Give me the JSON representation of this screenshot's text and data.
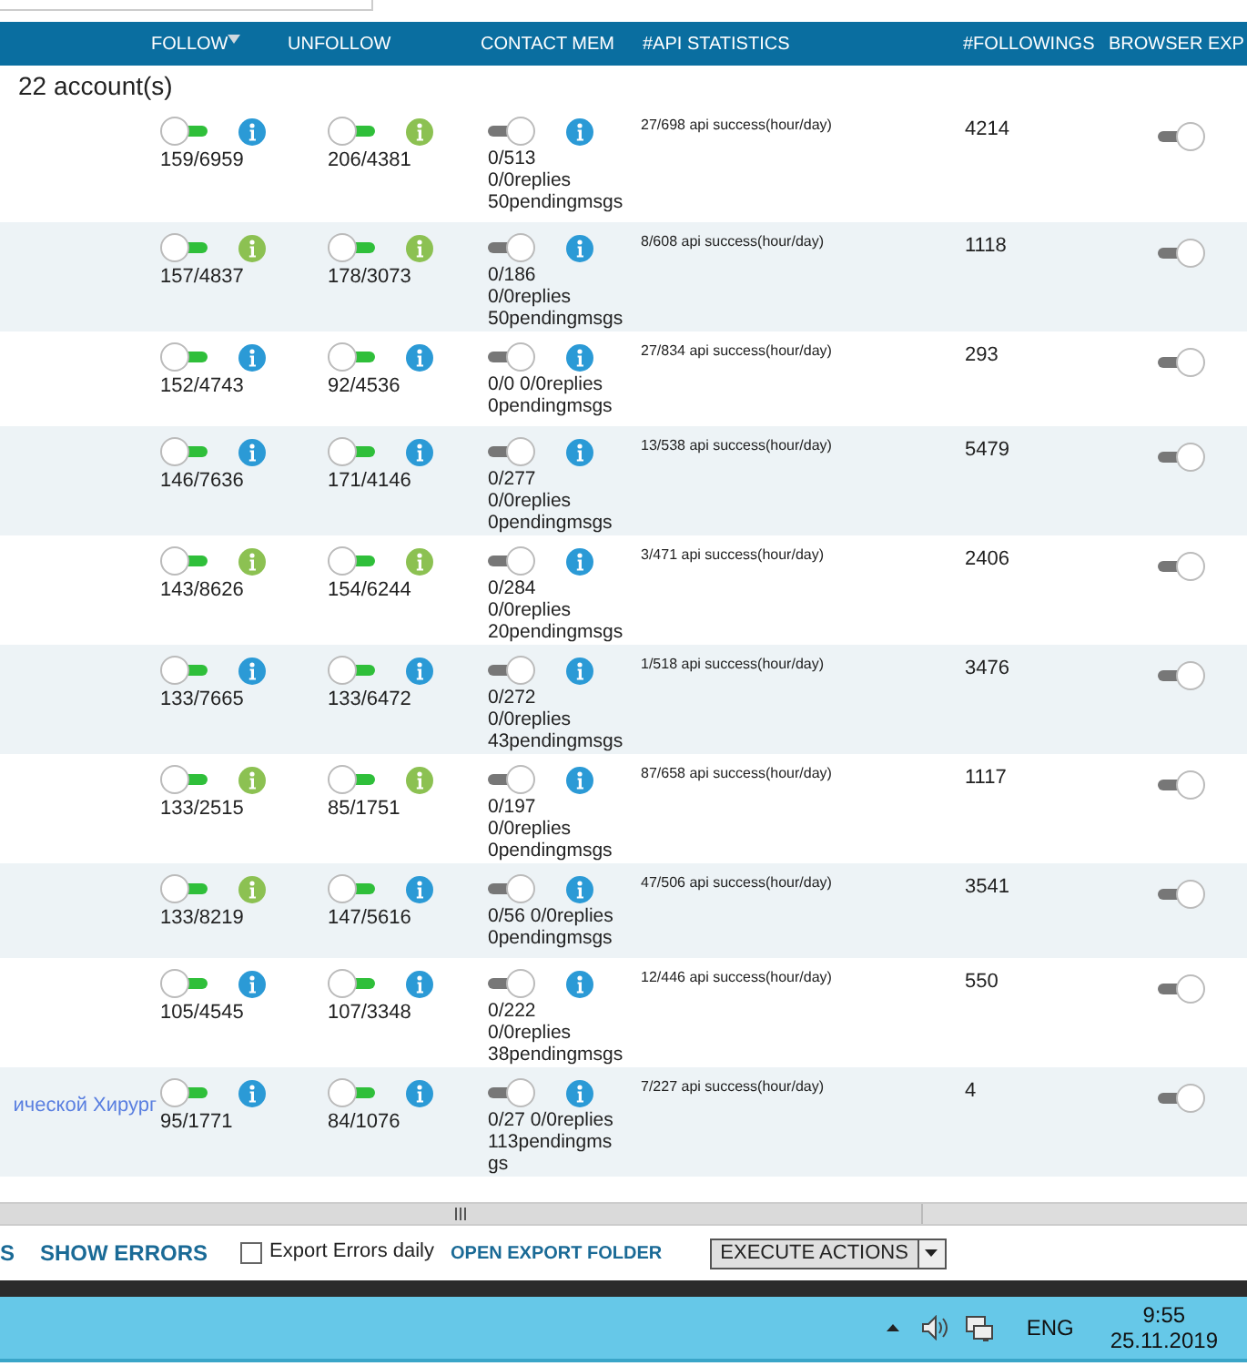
{
  "header": {
    "columns": [
      {
        "label": "FOLLOW",
        "sorted": true
      },
      {
        "label": "UNFOLLOW",
        "sorted": false
      },
      {
        "label": "CONTACT MEM",
        "sorted": false
      },
      {
        "label": "#API STATISTICS",
        "sorted": false
      },
      {
        "label": "#FOLLOWINGS",
        "sorted": false
      },
      {
        "label": "BROWSER EXP",
        "sorted": false
      }
    ]
  },
  "account_count": "22 account(s)",
  "rows": [
    {
      "follow": {
        "on": true,
        "color": "#2b9ad6",
        "count": "159/6959"
      },
      "unfollow": {
        "on": true,
        "color": "#8cc152",
        "count": "206/4381"
      },
      "contact": {
        "on": false,
        "color": "#2b9ad6",
        "lines": [
          "0/513",
          "0/0replies",
          "50pendingmsgs"
        ]
      },
      "api": "27/698 api success(hour/day)",
      "followings": "4214",
      "browser_on": false
    },
    {
      "follow": {
        "on": true,
        "color": "#8cc152",
        "count": "157/4837"
      },
      "unfollow": {
        "on": true,
        "color": "#8cc152",
        "count": "178/3073"
      },
      "contact": {
        "on": false,
        "color": "#2b9ad6",
        "lines": [
          "0/186",
          "0/0replies",
          "50pendingmsgs"
        ]
      },
      "api": "8/608 api success(hour/day)",
      "followings": "1118",
      "browser_on": false
    },
    {
      "follow": {
        "on": true,
        "color": "#2b9ad6",
        "count": "152/4743"
      },
      "unfollow": {
        "on": true,
        "color": "#2b9ad6",
        "count": "92/4536"
      },
      "contact": {
        "on": false,
        "color": "#2b9ad6",
        "lines": [
          "0/0 0/0replies",
          "0pendingmsgs"
        ]
      },
      "api": "27/834 api success(hour/day)",
      "followings": "293",
      "browser_on": false
    },
    {
      "follow": {
        "on": true,
        "color": "#2b9ad6",
        "count": "146/7636"
      },
      "unfollow": {
        "on": true,
        "color": "#2b9ad6",
        "count": "171/4146"
      },
      "contact": {
        "on": false,
        "color": "#2b9ad6",
        "lines": [
          "0/277",
          "0/0replies",
          "0pendingmsgs"
        ]
      },
      "api": "13/538 api success(hour/day)",
      "followings": "5479",
      "browser_on": false
    },
    {
      "follow": {
        "on": true,
        "color": "#8cc152",
        "count": "143/8626"
      },
      "unfollow": {
        "on": true,
        "color": "#8cc152",
        "count": "154/6244"
      },
      "contact": {
        "on": false,
        "color": "#2b9ad6",
        "lines": [
          "0/284",
          "0/0replies",
          "20pendingmsgs"
        ]
      },
      "api": "3/471 api success(hour/day)",
      "followings": "2406",
      "browser_on": false
    },
    {
      "follow": {
        "on": true,
        "color": "#2b9ad6",
        "count": "133/7665"
      },
      "unfollow": {
        "on": true,
        "color": "#2b9ad6",
        "count": "133/6472"
      },
      "contact": {
        "on": false,
        "color": "#2b9ad6",
        "lines": [
          "0/272",
          "0/0replies",
          "43pendingmsgs"
        ]
      },
      "api": "1/518 api success(hour/day)",
      "followings": "3476",
      "browser_on": false
    },
    {
      "follow": {
        "on": true,
        "color": "#8cc152",
        "count": "133/2515"
      },
      "unfollow": {
        "on": true,
        "color": "#8cc152",
        "count": "85/1751"
      },
      "contact": {
        "on": false,
        "color": "#2b9ad6",
        "lines": [
          "0/197",
          "0/0replies",
          "0pendingmsgs"
        ]
      },
      "api": "87/658 api success(hour/day)",
      "followings": "1117",
      "browser_on": false
    },
    {
      "follow": {
        "on": true,
        "color": "#8cc152",
        "count": "133/8219"
      },
      "unfollow": {
        "on": true,
        "color": "#2b9ad6",
        "count": "147/5616"
      },
      "contact": {
        "on": false,
        "color": "#2b9ad6",
        "lines": [
          "0/56 0/0replies",
          "0pendingmsgs"
        ]
      },
      "api": "47/506 api success(hour/day)",
      "followings": "3541",
      "browser_on": false
    },
    {
      "follow": {
        "on": true,
        "color": "#2b9ad6",
        "count": "105/4545"
      },
      "unfollow": {
        "on": true,
        "color": "#2b9ad6",
        "count": "107/3348"
      },
      "contact": {
        "on": false,
        "color": "#2b9ad6",
        "lines": [
          "0/222",
          "0/0replies",
          "38pendingmsgs"
        ]
      },
      "api": "12/446 api success(hour/day)",
      "followings": "550",
      "browser_on": false
    },
    {
      "account": "ической Хирург",
      "follow": {
        "on": true,
        "color": "#2b9ad6",
        "count": "95/1771"
      },
      "unfollow": {
        "on": true,
        "color": "#2b9ad6",
        "count": "84/1076"
      },
      "contact": {
        "on": false,
        "color": "#2b9ad6",
        "lines": [
          "0/27 0/0replies",
          "113pendingms",
          "gs"
        ]
      },
      "api": "7/227 api success(hour/day)",
      "followings": "4",
      "browser_on": false
    }
  ],
  "footer": {
    "link_cut": "S",
    "show_errors": "SHOW ERRORS",
    "export_daily": {
      "label": "Export Errors daily",
      "checked": false
    },
    "open_folder": "OPEN EXPORT FOLDER",
    "execute": "EXECUTE ACTIONS"
  },
  "taskbar": {
    "language": "ENG",
    "time": "9:55",
    "date": "25.11.2019"
  }
}
